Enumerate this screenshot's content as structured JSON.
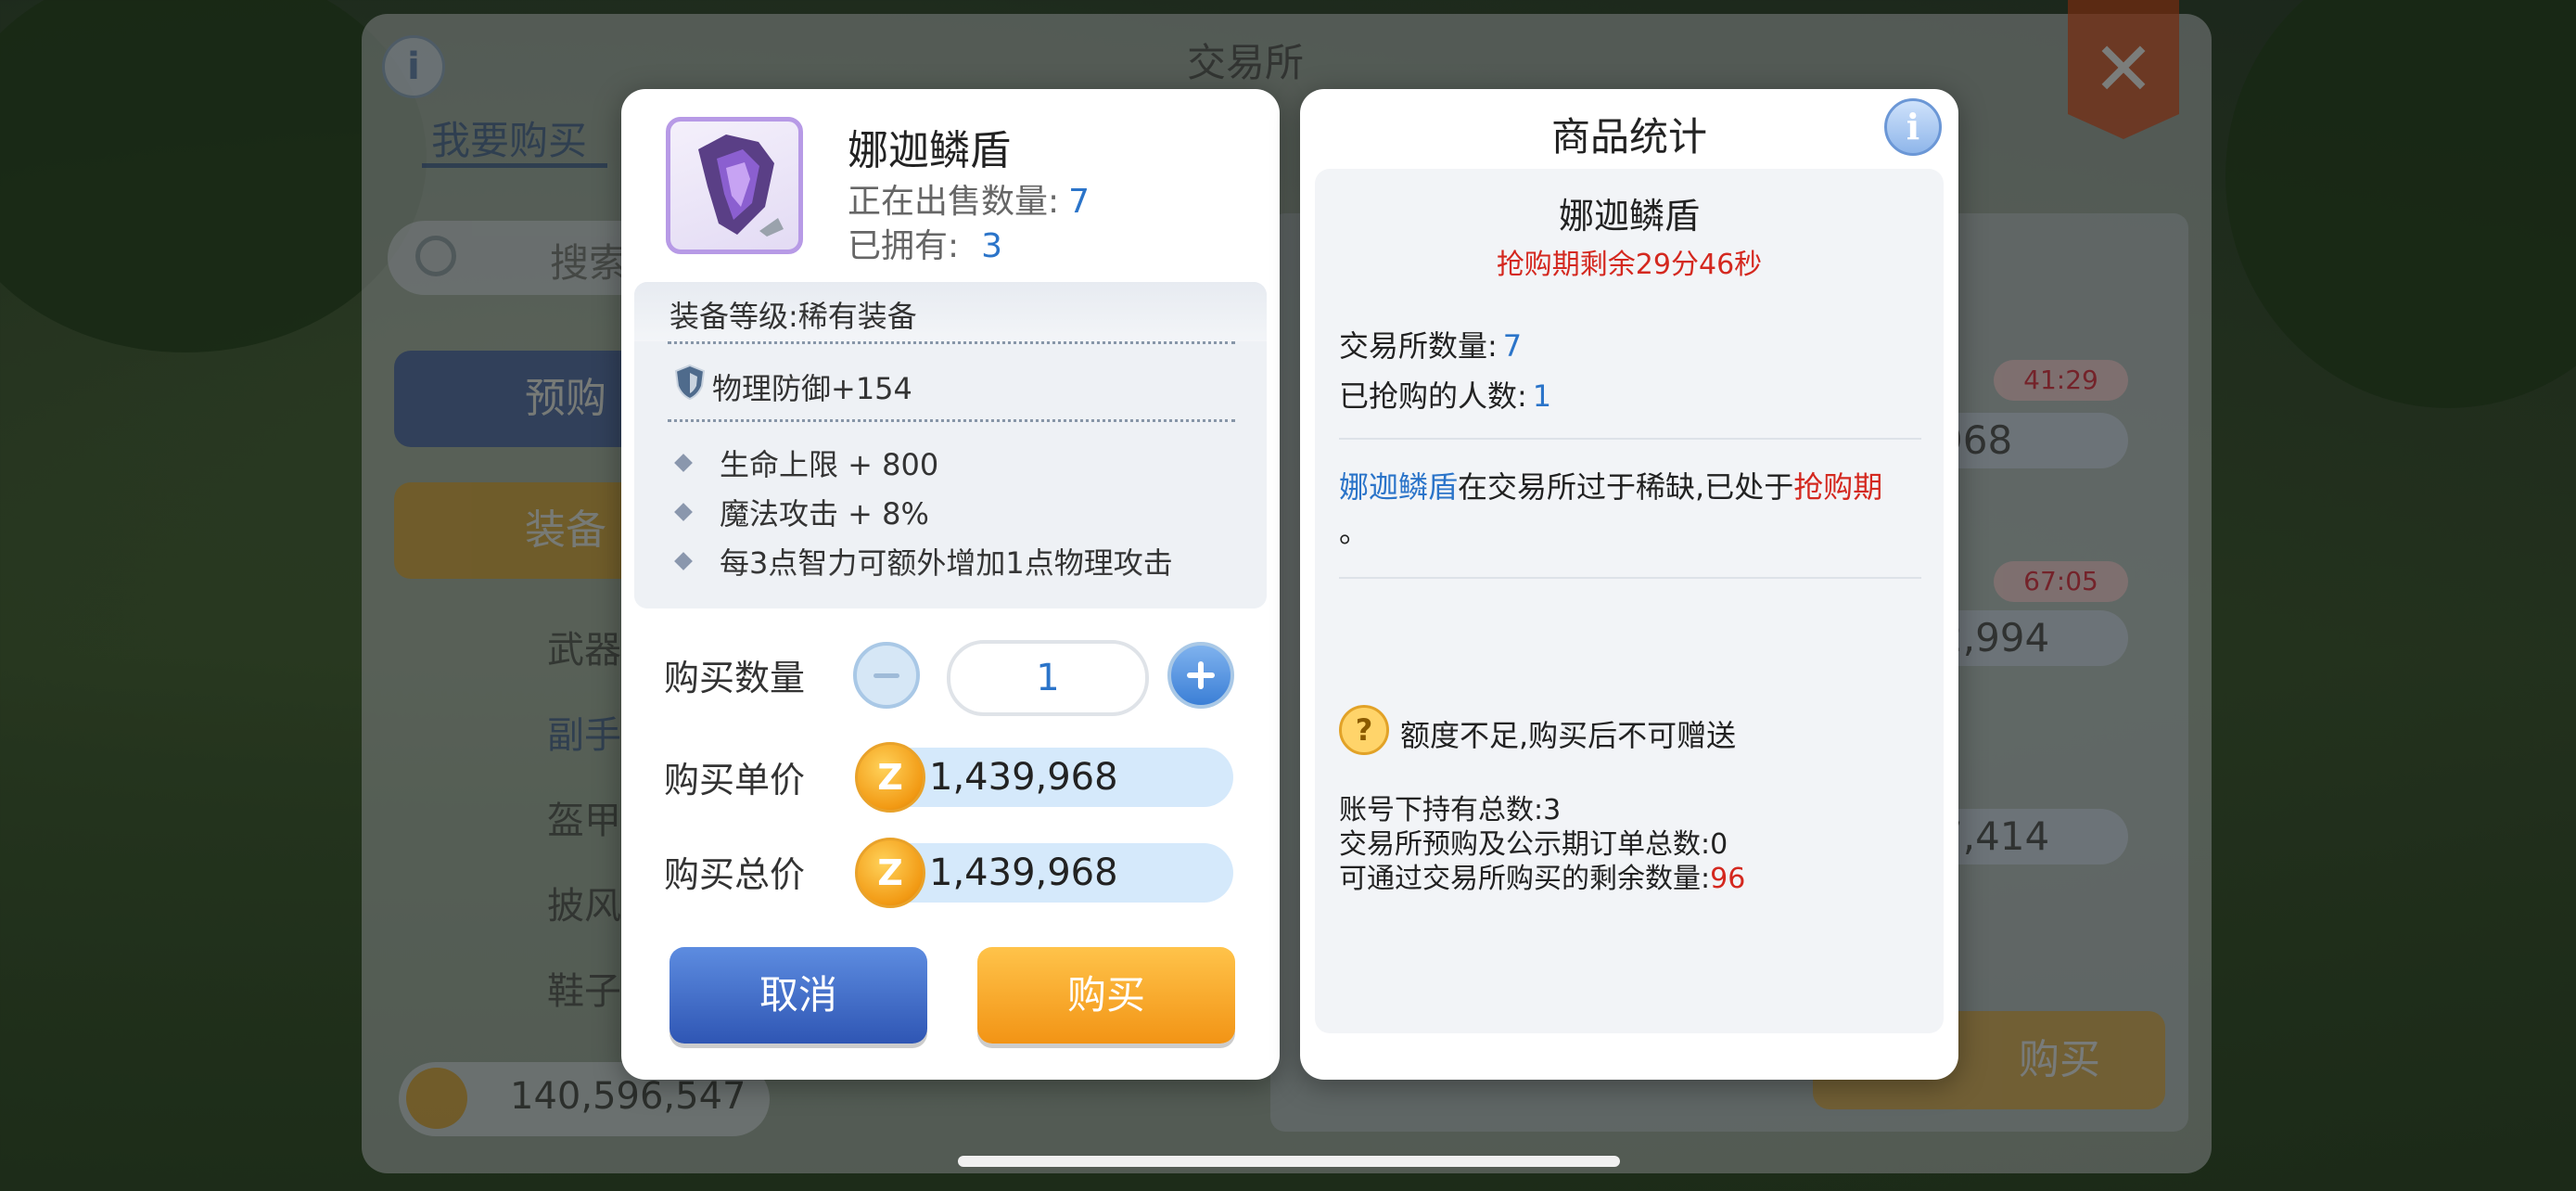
{
  "background": {
    "title": "交易所",
    "tab_active": "我要购买",
    "search_placeholder": "搜索",
    "preorder_label": "预购",
    "equip_label": "装备",
    "categories": [
      "武器",
      "副手",
      "盔甲",
      "披风",
      "鞋子"
    ],
    "balance": "140,596,547",
    "timers": [
      "41:29",
      "67:05"
    ],
    "prices": [
      "968",
      "2,994",
      "7,414"
    ],
    "buy_label": "购买"
  },
  "buy_dialog": {
    "item_name": "娜迦鳞盾",
    "on_sale_label": "正在出售数量:",
    "on_sale_value": "7",
    "owned_label": "已拥有:",
    "owned_value": "3",
    "equip_grade": "装备等级:稀有装备",
    "main_stat": "物理防御+154",
    "sub_stats": [
      "生命上限 + 800",
      "魔法攻击 + 8%",
      "每3点智力可额外增加1点物理攻击"
    ],
    "qty_label": "购买数量",
    "qty_value": "1",
    "unit_price_label": "购买单价",
    "unit_price": "1,439,968",
    "total_price_label": "购买总价",
    "total_price": "1,439,968",
    "cancel_label": "取消",
    "buy_label": "购买"
  },
  "stats_dialog": {
    "title": "商品统计",
    "item_name": "娜迦鳞盾",
    "timer": "抢购期剩余29分46秒",
    "exchange_qty_label": "交易所数量:",
    "exchange_qty": "7",
    "grabbed_label": "已抢购的人数:",
    "grabbed": "1",
    "desc_item": "娜迦鳞盾",
    "desc_mid": "在交易所过于稀缺,已处于",
    "desc_state": "抢购期",
    "desc_end": "。",
    "warning": "额度不足,购买后不可赠送",
    "total_hold": "账号下持有总数:3",
    "preorder_total": "交易所预购及公示期订单总数:0",
    "remain_label": "可通过交易所购买的剩余数量:",
    "remain_value": "96"
  },
  "colors": {
    "accent_blue": "#2b74c9",
    "alert_red": "#d4281f",
    "buy_orange": "#f29415",
    "cancel_blue": "#2f56b4"
  },
  "icons": [
    "info-icon",
    "close-icon",
    "search-icon",
    "coin-icon",
    "shield-icon",
    "question-icon",
    "plus-icon",
    "minus-icon"
  ]
}
